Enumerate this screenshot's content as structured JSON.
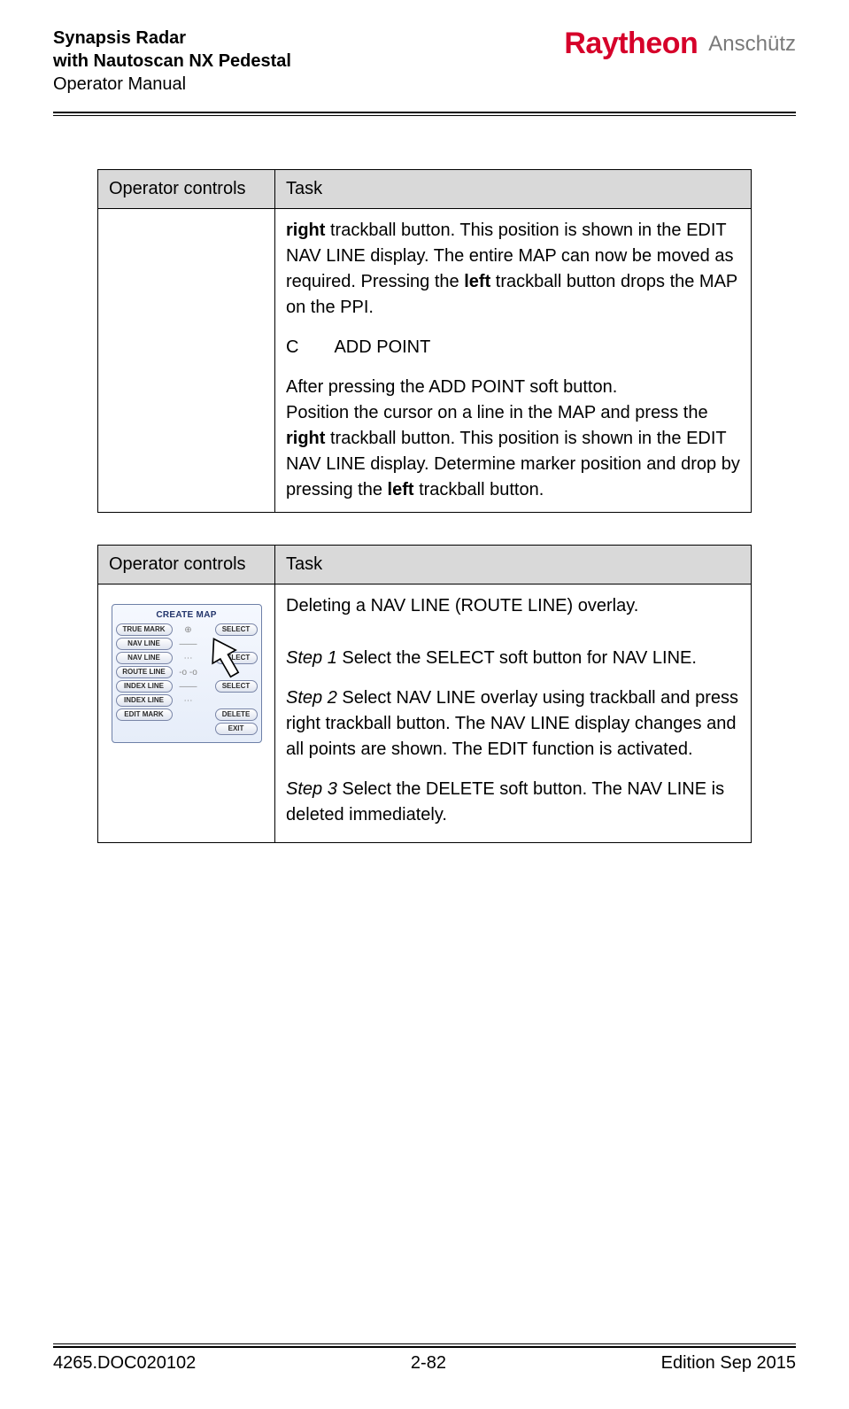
{
  "header": {
    "line1": "Synapsis Radar",
    "line2": "with Nautoscan NX Pedestal",
    "line3": "Operator Manual",
    "brand_main": "Raytheon",
    "brand_sub": "Anschütz"
  },
  "table1": {
    "col_operator": "Operator controls",
    "col_task": "Task",
    "para1_a": "right",
    "para1_b": " trackball button. This position is shown in the EDIT NAV LINE display. The entire MAP can now be moved as required. Pressing the ",
    "para1_c": "left",
    "para1_d": " trackball button drops the MAP on the PPI.",
    "para2": "C  ADD POINT",
    "para3": "After pressing the ADD POINT soft button.",
    "para4_a": "Position the cursor on a line in the MAP and press the ",
    "para4_b": "right",
    "para4_c": " trackball button. This position is shown in the EDIT NAV LINE display. Determine marker position and drop by pressing the ",
    "para4_d": "left",
    "para4_e": " trackball button."
  },
  "table2": {
    "col_operator": "Operator controls",
    "col_task": "Task",
    "para1": "Deleting a NAV LINE (ROUTE LINE) overlay.",
    "step1_i": "Step 1",
    "step1_t": " Select the SELECT soft button for NAV LINE.",
    "step2_i": "Step 2",
    "step2_t": " Select NAV LINE overlay using trackball and press right trackball button. The NAV LINE display changes and all points are shown. The EDIT function is activated.",
    "step3_i": "Step 3",
    "step3_t": " Select the DELETE soft button. The NAV LINE is deleted immediately."
  },
  "panel": {
    "title": "CREATE MAP",
    "rows": {
      "r1l": "TRUE MARK",
      "r1m": "⊕",
      "r1r": "SELECT",
      "r2l": "NAV LINE",
      "r3l": "NAV LINE",
      "r3r": "SELECT",
      "r4l": "ROUTE LINE",
      "r5l": "INDEX LINE",
      "r5r": "SELECT",
      "r6l": "INDEX LINE",
      "r7l": "EDIT MARK",
      "r7r": "DELETE",
      "r8r": "EXIT"
    }
  },
  "footer": {
    "left": "4265.DOC020102",
    "center": "2-82",
    "right": "Edition Sep 2015"
  }
}
